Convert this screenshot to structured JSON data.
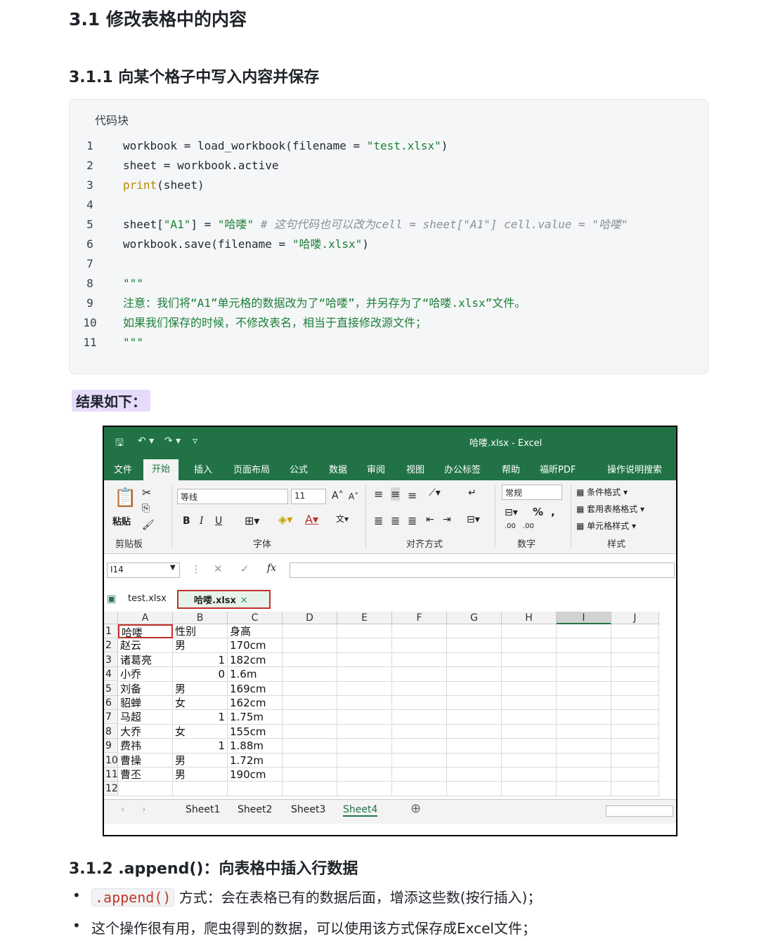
{
  "heading_main": "3.1 修改表格中的内容",
  "heading_sub": "3.1.1 向某个格子中写入内容并保存",
  "code_label": "代码块",
  "code_lines": [
    {
      "n": "1",
      "parts": [
        {
          "t": "workbook = load_workbook(filename = ",
          "c": "code-text"
        },
        {
          "t": "\"test.xlsx\"",
          "c": "str"
        },
        {
          "t": ")",
          "c": "code-text"
        }
      ]
    },
    {
      "n": "2",
      "parts": [
        {
          "t": "sheet = workbook.active",
          "c": "code-text"
        }
      ]
    },
    {
      "n": "3",
      "parts": [
        {
          "t": "print",
          "c": "kw-print"
        },
        {
          "t": "(sheet)",
          "c": "code-text"
        }
      ]
    },
    {
      "n": "4",
      "parts": []
    },
    {
      "n": "5",
      "parts": [
        {
          "t": "sheet[",
          "c": "code-text"
        },
        {
          "t": "\"A1\"",
          "c": "str"
        },
        {
          "t": "] = ",
          "c": "code-text"
        },
        {
          "t": "\"哈喽\"",
          "c": "str"
        },
        {
          "t": " # 这句代码也可以改为cell = sheet[\"A1\"] cell.value = \"哈喽\"",
          "c": "comment"
        }
      ]
    },
    {
      "n": "6",
      "parts": [
        {
          "t": "workbook.save(filename = ",
          "c": "code-text"
        },
        {
          "t": "\"哈喽.xlsx\"",
          "c": "str"
        },
        {
          "t": ")",
          "c": "code-text"
        }
      ]
    },
    {
      "n": "7",
      "parts": []
    },
    {
      "n": "8",
      "parts": [
        {
          "t": "\"\"\"",
          "c": "docstr"
        }
      ]
    },
    {
      "n": "9",
      "parts": [
        {
          "t": "注意：我们将“A1”单元格的数据改为了“哈喽”，并另存为了“哈喽.xlsx”文件。",
          "c": "docstr"
        }
      ]
    },
    {
      "n": "10",
      "parts": [
        {
          "t": "如果我们保存的时候，不修改表名，相当于直接修改源文件；",
          "c": "docstr"
        }
      ]
    },
    {
      "n": "11",
      "parts": [
        {
          "t": "\"\"\"",
          "c": "docstr"
        }
      ]
    }
  ],
  "result_label": "结果如下：",
  "excel": {
    "title": "哈喽.xlsx  -  Excel",
    "menu": [
      "文件",
      "开始",
      "插入",
      "页面布局",
      "公式",
      "数据",
      "审阅",
      "视图",
      "办公标签",
      "帮助",
      "福昕PDF",
      "操作说明搜索"
    ],
    "ribbon": {
      "paste": "粘贴",
      "clipboard": "剪贴板",
      "font_name": "等线",
      "font_size": "11",
      "font_group": "字体",
      "align_group": "对齐方式",
      "number_format": "常规",
      "number_group": "数字",
      "style_items": [
        "条件格式 ▾",
        "套用表格格式 ▾",
        "单元格样式 ▾"
      ],
      "style_group": "样式",
      "bold": "B",
      "italic": "I",
      "underline": "U",
      "percent": "%"
    },
    "name_box": "I14",
    "fx": "fx",
    "file_tabs": [
      "test.xlsx",
      "哈喽.xlsx"
    ],
    "columns": [
      "A",
      "B",
      "C",
      "D",
      "E",
      "F",
      "G",
      "H",
      "I",
      "J"
    ],
    "rows": [
      [
        "1",
        "哈喽",
        "性别",
        "身高"
      ],
      [
        "2",
        "赵云",
        "男",
        "170cm"
      ],
      [
        "3",
        "诸葛亮",
        "1",
        "182cm"
      ],
      [
        "4",
        "小乔",
        "0",
        "1.6m"
      ],
      [
        "5",
        "刘备",
        "男",
        "169cm"
      ],
      [
        "6",
        "貂蝉",
        "女",
        "162cm"
      ],
      [
        "7",
        "马超",
        "1",
        "1.75m"
      ],
      [
        "8",
        "大乔",
        "女",
        "155cm"
      ],
      [
        "9",
        "费祎",
        "1",
        "1.88m"
      ],
      [
        "10",
        "曹操",
        "男",
        "1.72m"
      ],
      [
        "11",
        "曹丕",
        "男",
        "190cm"
      ],
      [
        "12",
        "",
        "",
        ""
      ]
    ],
    "sheets": [
      "Sheet1",
      "Sheet2",
      "Sheet3",
      "Sheet4"
    ],
    "add_sheet": "⊕"
  },
  "heading_append": "3.1.2 .append()：向表格中插入行数据",
  "bullets": [
    {
      "code": ".append()",
      "text": "方式：会在表格已有的数据后面，增添这些数(按行插入)；"
    },
    {
      "code": "",
      "text": "这个操作很有用，爬虫得到的数据，可以使用该方式保存成Excel文件；"
    }
  ]
}
